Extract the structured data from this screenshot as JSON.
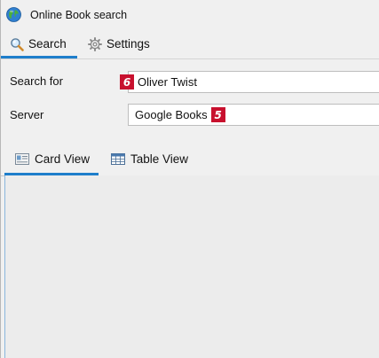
{
  "window": {
    "title": "Online Book search",
    "icon": "globe-icon"
  },
  "main_tabs": [
    {
      "label": "Search",
      "icon": "magnifier-icon",
      "active": true
    },
    {
      "label": "Settings",
      "icon": "gear-icon",
      "active": false
    }
  ],
  "form": {
    "search_label": "Search for",
    "search_value": "Oliver Twist",
    "search_badge": "6",
    "server_label": "Server",
    "server_value": "Google Books",
    "server_badge": "5"
  },
  "view_tabs": [
    {
      "label": "Card View",
      "icon": "card-view-icon",
      "active": true
    },
    {
      "label": "Table View",
      "icon": "table-view-icon",
      "active": false
    }
  ],
  "colors": {
    "accent": "#1e7ecb",
    "badge": "#c8102e",
    "background": "#f0f0f0"
  }
}
